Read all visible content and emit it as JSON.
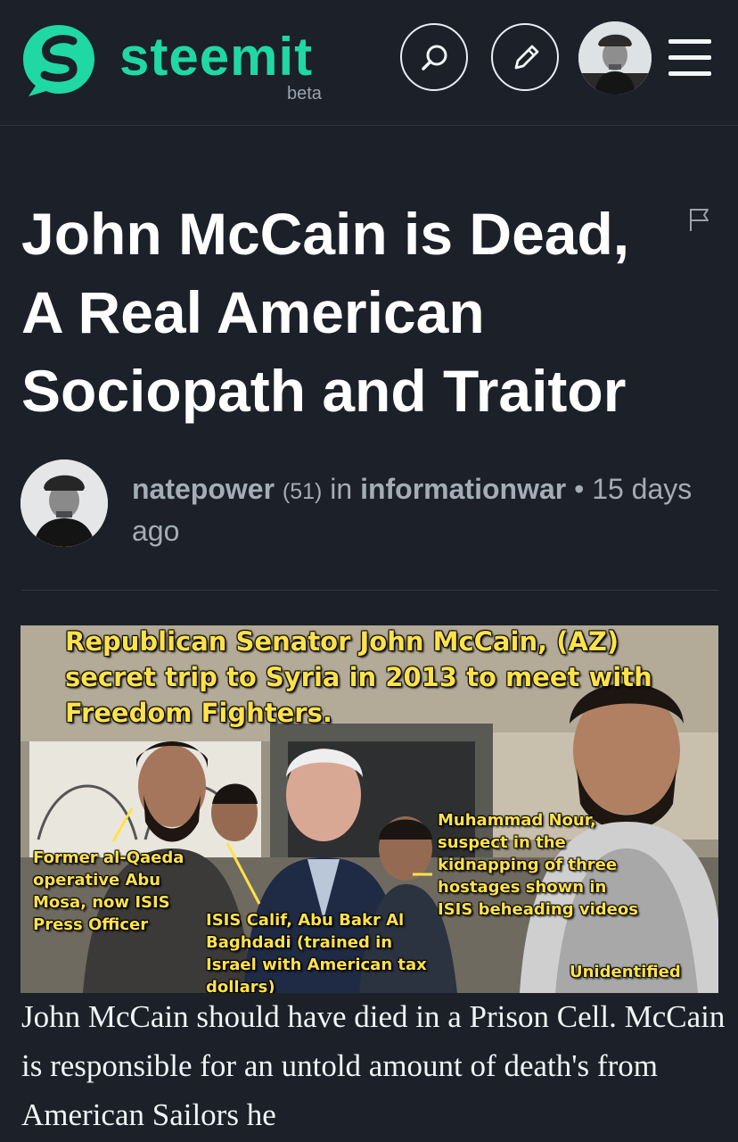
{
  "header": {
    "logo_text": "steemit",
    "logo_badge": "beta",
    "icons": [
      "steemit-logo-icon",
      "search-icon",
      "pencil-icon",
      "avatar",
      "hamburger-menu-icon"
    ],
    "brand_color": "#1fd8a4",
    "background_color": "#1b2029"
  },
  "post": {
    "title": "John McCain is Dead, A Real American Sociopath and Traitor",
    "author": "natepower",
    "reputation": "(51)",
    "in_word": "in",
    "community": "informationwar",
    "separator": "•",
    "time_ago": "15 days ago",
    "image": {
      "headline": "Republican Senator John McCain, (AZ) secret trip to Syria in 2013 to meet with Freedom Fighters.",
      "label_1": "Former al-Qaeda operative Abu Mosa, now ISIS Press Officer",
      "label_2": "ISIS Calif, Abu Bakr Al Baghdadi (trained in Israel with American tax dollars)",
      "label_3": "Muhammad Nour, suspect in the kidnapping of three hostages shown in ISIS beheading videos",
      "label_4": "Unidentified",
      "caption_color": "#ffe24a"
    },
    "body": "John McCain should have died in a Prison Cell. McCain is responsible for an untold amount of death's from American Sailors he"
  }
}
